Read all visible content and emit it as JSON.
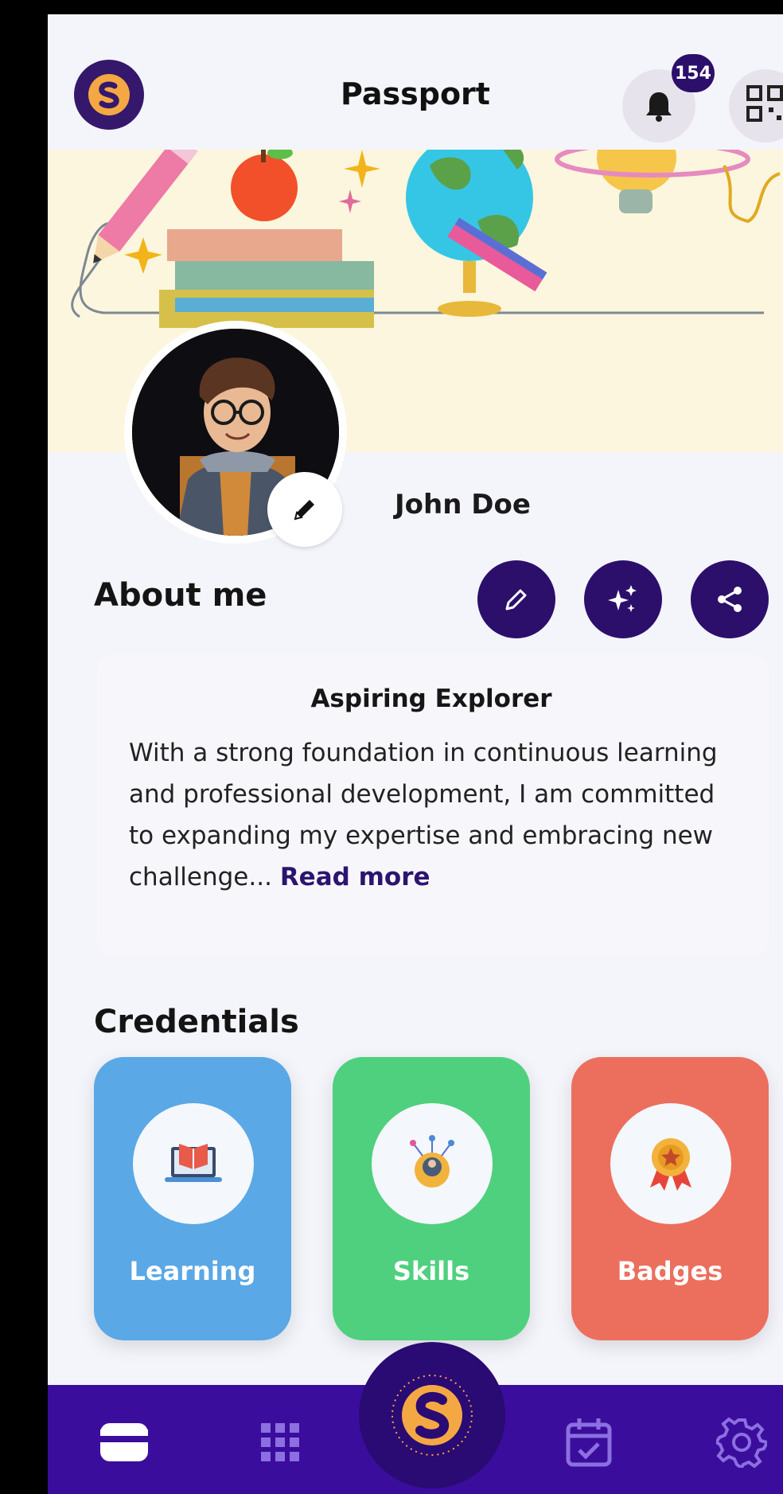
{
  "header": {
    "title": "Passport",
    "notification_count": "154"
  },
  "profile": {
    "name": "John Doe"
  },
  "about": {
    "section_title": "About me",
    "heading": "Aspiring Explorer",
    "text": "With a strong foundation in continuous learning and professional development, I am committed to expanding my expertise and embracing new challenge...",
    "read_more": "Read more",
    "actions": [
      "edit",
      "sparkle",
      "share"
    ]
  },
  "credentials": {
    "section_title": "Credentials",
    "cards": [
      {
        "label": "Learning",
        "icon": "laptop-book-icon",
        "color": "#5aa8e6"
      },
      {
        "label": "Skills",
        "icon": "gear-person-icon",
        "color": "#4fd07e"
      },
      {
        "label": "Badges",
        "icon": "medal-icon",
        "color": "#ec6f5e"
      }
    ]
  },
  "bottom_nav": {
    "items": [
      "wallet-icon",
      "grid-icon",
      "home-logo",
      "calendar-check-icon",
      "settings-gear-icon"
    ],
    "active": "wallet-icon"
  },
  "colors": {
    "brand_purple": "#2c0f6a",
    "nav_purple": "#3a0d9c",
    "accent_orange": "#f4a843",
    "banner_bg": "#fbf6dd"
  }
}
